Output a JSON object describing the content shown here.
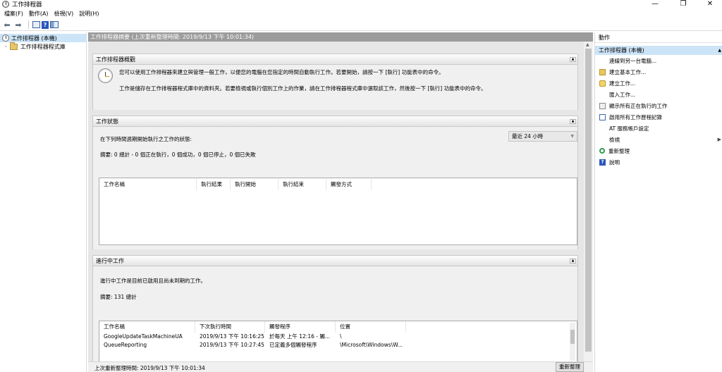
{
  "window": {
    "title": "工作排程器",
    "minimize": "—",
    "maximize": "❐",
    "close": "✕"
  },
  "menu": [
    "檔案(F)",
    "動作(A)",
    "檢視(V)",
    "說明(H)"
  ],
  "toolbar": {
    "back": "⬅",
    "forward": "➡",
    "help": "?"
  },
  "tree": {
    "root": "工作排程器 (本機)",
    "child": "工作排程器程式庫",
    "expander": "›"
  },
  "center": {
    "header": "工作排程器摘要 (上次重新整理時間: 2019/9/13 下午 10:01:34)",
    "overview": {
      "title": "工作排程器概觀",
      "line1": "您可以使用工作排程器來建立與管理一般工作，以便您的電腦在您指定的時間自動執行工作。若要開始，請按一下 [執行] 功能表中的命令。",
      "line2": "工作是儲存在工作排程器程式庫中的資料夾。若要檢視或執行個別工作上的作業，請在工作排程器程式庫中選取該工作，然後按一下 [執行] 功能表中的命令。"
    },
    "status": {
      "title": "工作狀態",
      "period_label": "在下列時間週期開始執行之工作的狀態:",
      "period_value": "最近 24 小時",
      "summary": "摘要: 0 總計 - 0 個正在執行，0 個成功，0 個已停止，0 個已失敗",
      "columns": [
        "工作名稱",
        "執行結果",
        "執行開始",
        "執行結束",
        "觸發方式"
      ]
    },
    "active": {
      "title": "進行中工作",
      "desc": "進行中工作是目前已啟用且尚未到期的工作。",
      "summary": "摘要: 131 總計",
      "columns": [
        "工作名稱",
        "下次執行時間",
        "觸發程序",
        "位置"
      ],
      "rows": [
        [
          "GoogleUpdateTaskMachineUA",
          "2019/9/13 下午 10:16:25",
          "於每天 上午 12:16 - 觸...",
          "\\"
        ],
        [
          "QueueReporting",
          "2019/9/13 下午 10:27:45",
          "已定義多個觸發程序",
          "\\Microsoft\\Windows\\W..."
        ]
      ]
    },
    "statusbar": {
      "last_refresh": "上次重新整理時間: 2019/9/13 下午 10:01:34",
      "refresh_button": "重新整理"
    }
  },
  "actions": {
    "title": "動作",
    "group": "工作排程器 (本機)",
    "items": [
      "連線到另一台電腦...",
      "建立基本工作...",
      "建立工作...",
      "匯入工作...",
      "顯示所有正在執行的工作",
      "啟用所有工作歷程記錄",
      "AT 服務帳戶設定",
      "檢視",
      "重新整理",
      "說明"
    ]
  }
}
